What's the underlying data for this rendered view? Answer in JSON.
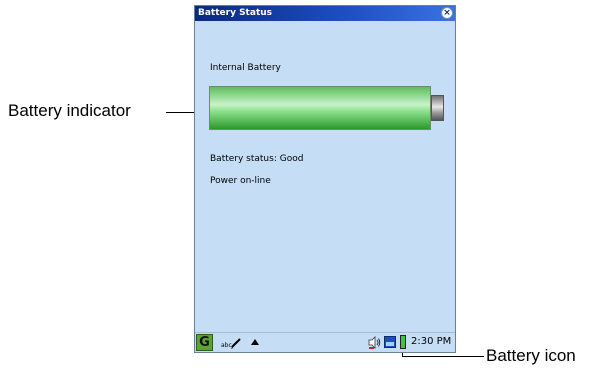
{
  "window": {
    "title": "Battery Status",
    "close_symbol": "×"
  },
  "content": {
    "battery_heading": "Internal Battery",
    "battery_level_fraction": 1.0,
    "status_text": "Battery status: Good",
    "power_text": "Power on-line"
  },
  "taskbar": {
    "start_symbol": "G",
    "input_method": "abc",
    "clock": "2:30 PM"
  },
  "callouts": {
    "indicator_label": "Battery indicator",
    "icon_label": "Battery icon"
  },
  "colors": {
    "background": "#c6ddf6",
    "titlebar": "#1c4cc0",
    "battery_fill": "#5cbf5c"
  }
}
